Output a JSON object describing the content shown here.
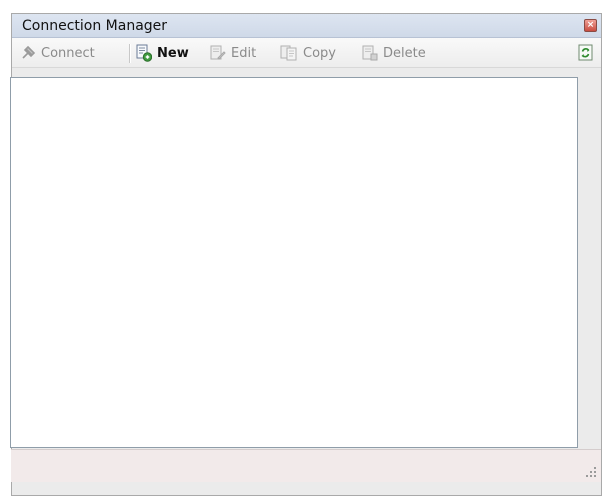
{
  "window": {
    "title": "Connection Manager",
    "close_icon": "close-icon"
  },
  "toolbar": {
    "connect_label": "Connect",
    "new_label": "New",
    "edit_label": "Edit",
    "copy_label": "Copy",
    "delete_label": "Delete",
    "refresh_icon": "refresh-icon"
  },
  "connections": [],
  "colors": {
    "title_bar": "#d3dcea",
    "status_bar": "#f2eaea",
    "disabled_text": "#8a8a8a"
  }
}
